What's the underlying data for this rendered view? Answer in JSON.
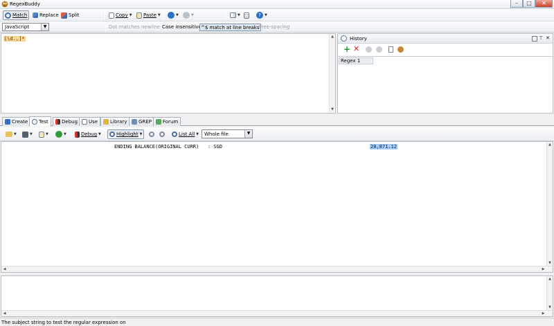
{
  "window": {
    "title": "RegexBuddy",
    "minimize": "–",
    "maximize": "□",
    "close": "✕"
  },
  "toolbar": {
    "match_label": "Match",
    "replace_label": "Replace",
    "split_label": "Split",
    "copy_label": "Copy",
    "paste_label": "Paste"
  },
  "options": {
    "flavor": "JavaScript",
    "dot_matches_newline": "Dot matches newline",
    "case_insensitive": "Case insensitive",
    "caret_dollar": "^$ match at line breaks",
    "free_spacing": "Free-spacing"
  },
  "regex": {
    "text": "[\\d.,]*"
  },
  "history": {
    "title": "History",
    "items": [
      "Regex 1"
    ]
  },
  "tabs": [
    {
      "label": "Create",
      "icon": "create-icon"
    },
    {
      "label": "Test",
      "icon": "test-icon"
    },
    {
      "label": "Debug",
      "icon": "debug-icon"
    },
    {
      "label": "Use",
      "icon": "use-icon"
    },
    {
      "label": "Library",
      "icon": "library-icon"
    },
    {
      "label": "GREP",
      "icon": "grep-icon"
    },
    {
      "label": "Forum",
      "icon": "forum-icon"
    }
  ],
  "test_toolbar": {
    "debug_label": "Debug",
    "highlight_label": "Highlight",
    "list_all_label": "List All",
    "scope": "Whole file"
  },
  "subject": {
    "line_text": "ENDING BALANCE(ORIGINAL CURR)   : SGD",
    "match_text": "28,871.12"
  },
  "status": {
    "text": "The subject string to test the regular expression on"
  },
  "colors": {
    "regex_highlight": "#f6d694",
    "match_highlight": "#a9cdf2",
    "accent": "#3a6ea5"
  }
}
